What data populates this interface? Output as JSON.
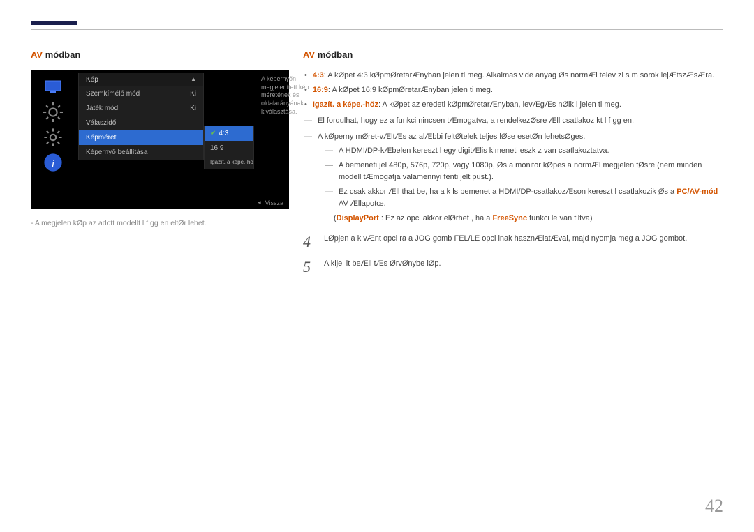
{
  "header": {
    "left_heading_orange": "AV",
    "left_heading_black": " módban",
    "right_heading_orange": "AV",
    "right_heading_black": " módban"
  },
  "osd": {
    "menu_title": "Kép",
    "rows": [
      {
        "label": "Szemkímélő mód",
        "value": "Ki"
      },
      {
        "label": "Játék mód",
        "value": "Ki"
      },
      {
        "label": "Válaszidő",
        "value": ""
      },
      {
        "label": "Képméret",
        "value": ""
      },
      {
        "label": "Képernyő beállítása",
        "value": ""
      }
    ],
    "submenu": [
      {
        "label": "4:3",
        "checked": true
      },
      {
        "label": "16:9",
        "checked": false
      },
      {
        "label": "Igazít. a képe.-höz",
        "checked": false
      }
    ],
    "help_text": "A képernyőn megjelenített kép méretének és oldalarányának kiválasztása.",
    "back_label": "Vissza"
  },
  "left_note": "- A megjelen  kØp az adott modellt l f gg en eltØr  lehet.",
  "right": {
    "bullets": [
      {
        "bold": "4:3",
        "bold_orange": true,
        "text": ": A kØpet 4:3 kØpmØretarÆnyban jelen ti meg. Alkalmas vide anyag Øs normÆl telev zi s m sorok lejÆtszÆsÆra."
      },
      {
        "bold": "16:9",
        "bold_orange": true,
        "text": ": A kØpet 16:9 kØpmØretarÆnyban jelen ti meg."
      },
      {
        "bold": "Igazít. a képe.-höz",
        "bold_orange": true,
        "text": ": A kØpet az eredeti kØpmØretarÆnyban, levÆgÆs nØlk l jelen ti meg."
      }
    ],
    "note1": "El fordulhat, hogy ez a funkci  nincsen tÆmogatva, a rendelkezØsre Æll  csatlakoz kt l f gg en.",
    "note2": "A kØperny mØret-vÆltÆs az alÆbbi feltØtelek teljes lØse esetØn lehetsØges.",
    "subnotes": [
      "A HDMI/DP-kÆbelen kereszt l egy digitÆlis kimeneti eszk z van csatlakoztatva.",
      "A bemeneti jel 480p, 576p, 720p, vagy 1080p, Øs a monitor kØpes a normÆl megjelen tØsre (nem minden modell tÆmogatja valamennyi fenti jelt pust.).",
      "Ez csak akkor Æll that  be, ha a k ls  bemenet a HDMI/DP-csatlakozÆson kereszt l csatlakozik Øs a"
    ],
    "pc_av_mod": "PC/AV-mód",
    "av_end": " AV Ællapotœ.",
    "displayport_line_1": "DisplayPort",
    "displayport_line_2": " : Ez az opci  akkor elØrhet , ha a ",
    "displayport_line_3": "FreeSync",
    "displayport_line_4": " funkci  le van tiltva)",
    "step4": "LØpjen a k vÆnt opci ra a JOG gomb FEL/LE opci inak hasznÆlatÆval, majd nyomja meg a JOG gombot.",
    "step5": "A kijel lt beÆll tÆs ØrvØnybe lØp."
  },
  "page_number": "42"
}
